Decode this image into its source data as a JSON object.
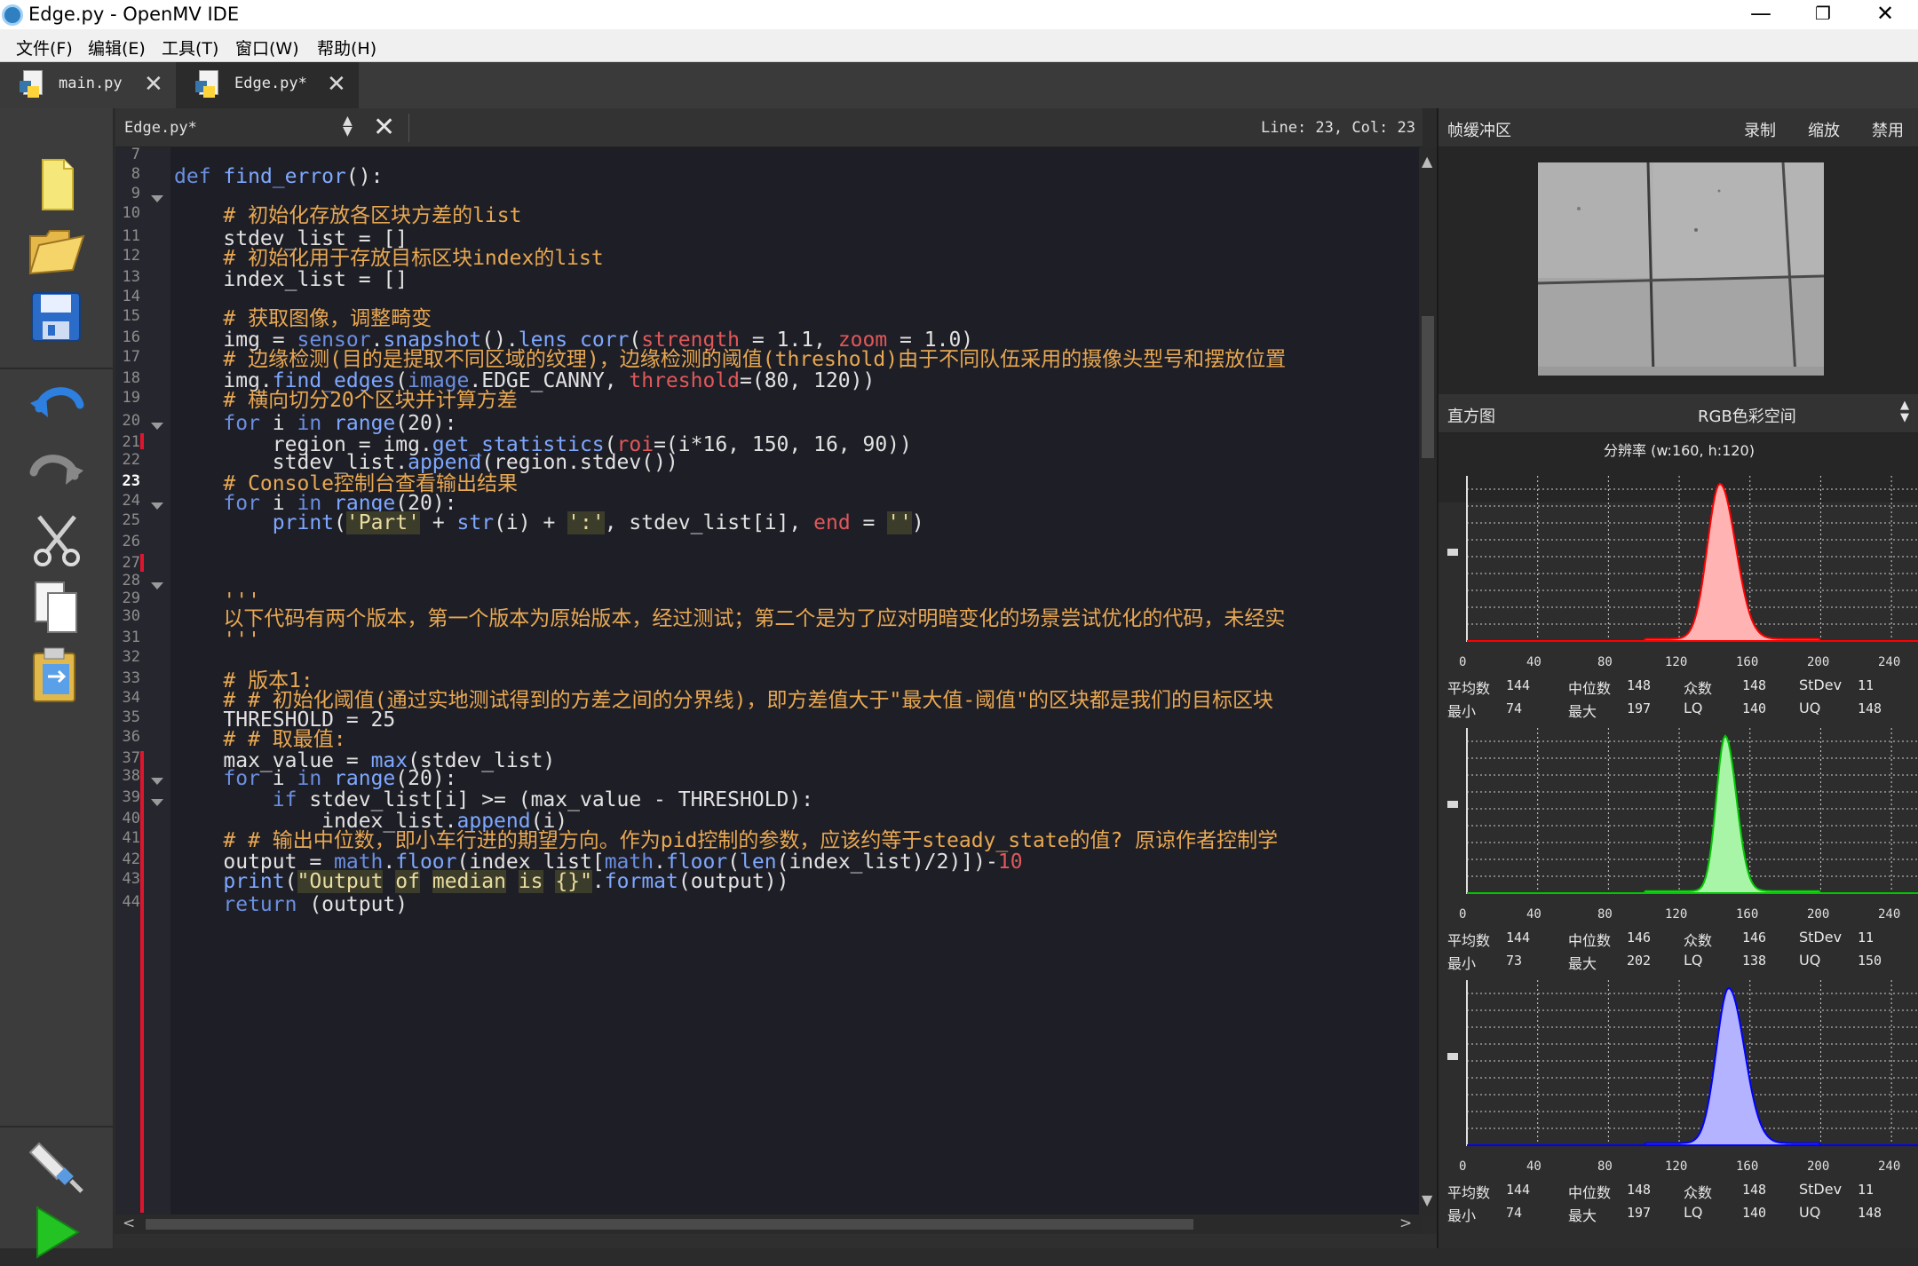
{
  "window": {
    "title": "Edge.py - OpenMV IDE",
    "minimize": "—",
    "restore": "❐",
    "close": "✕"
  },
  "menubar": [
    "文件(F)",
    "编辑(E)",
    "工具(T)",
    "窗口(W)",
    "帮助(H)"
  ],
  "tabs": [
    {
      "label": "main.py",
      "close": "✕"
    },
    {
      "label": "Edge.py*",
      "close": "✕"
    }
  ],
  "toolbar": [
    "new-file",
    "open-folder",
    "save",
    "undo",
    "redo",
    "cut",
    "copy",
    "paste",
    "connect",
    "run"
  ],
  "editor": {
    "doc_name": "Edge.py*",
    "position": "Line: 23, Col: 23",
    "lines": [
      {
        "n": "7",
        "html": ""
      },
      {
        "n": "8",
        "html": "<span class=\"kw\">def</span> <span class=\"fn\">find_error</span>():"
      },
      {
        "n": "9",
        "html": ""
      },
      {
        "n": "10",
        "html": "    <span class=\"cm\"># 初始化存放各区块方差的list</span>"
      },
      {
        "n": "11",
        "html": "    stdev_list = []"
      },
      {
        "n": "12",
        "html": "    <span class=\"cm\"># 初始化用于存放目标区块index的list</span>"
      },
      {
        "n": "13",
        "html": "    index_list = []"
      },
      {
        "n": "14",
        "html": ""
      },
      {
        "n": "15",
        "html": "    <span class=\"cm\"># 获取图像，调整畸变</span>"
      },
      {
        "n": "16",
        "html": "    img = <span class=\"ob\">sensor</span>.<span class=\"fn\">snapshot</span>().<span class=\"fn\">lens_corr</span>(<span class=\"ar\">strength</span> = 1.1, <span class=\"ar\">zoom</span> = 1.0)"
      },
      {
        "n": "17",
        "html": "    <span class=\"cm\"># 边缘检测(目的是提取不同区域的纹理)，边缘检测的阈值(threshold)由于不同队伍采用的摄像头型号和摆放位置</span>"
      },
      {
        "n": "18",
        "html": "    img.<span class=\"fn\">find_edges</span>(<span class=\"ob\">image</span>.EDGE_CANNY, <span class=\"ar\">threshold</span>=(80, 120))"
      },
      {
        "n": "19",
        "html": "    <span class=\"cm\"># 横向切分20个区块并计算方差</span>"
      },
      {
        "n": "20",
        "html": "    <span class=\"kw\">for</span> i <span class=\"kw\">in</span> <span class=\"fn\">range</span>(20):"
      },
      {
        "n": "21",
        "html": "        region = img.<span class=\"fn\">get_statistics</span>(<span class=\"ar\">roi</span>=(i*16, 150, 16, 90))"
      },
      {
        "n": "22",
        "html": "        stdev_list.<span class=\"fn\">append</span>(region.stdev())"
      },
      {
        "n": "23",
        "html": "    <span class=\"cm\"># Console控制台查看输出结果</span>"
      },
      {
        "n": "24",
        "html": "    <span class=\"kw\">for</span> i <span class=\"kw\">in</span> <span class=\"fn\">range</span>(20):"
      },
      {
        "n": "25",
        "html": "        <span class=\"fn\">print</span>(<span class=\"st\">'Part'</span> + <span class=\"fn\">str</span>(i) + <span class=\"st\">':'</span>, stdev_list[i], <span class=\"ar\">end</span> = <span class=\"st\">''</span>)"
      },
      {
        "n": "26",
        "html": ""
      },
      {
        "n": "27",
        "html": ""
      },
      {
        "n": "28",
        "html": ""
      },
      {
        "n": "29",
        "html": "    <span class=\"cm\">'''</span>"
      },
      {
        "n": "30",
        "html": "    <span class=\"cm\">以下代码有两个版本，第一个版本为原始版本，经过测试；第二个是为了应对明暗变化的场景尝试优化的代码，未经实</span>"
      },
      {
        "n": "31",
        "html": "    <span class=\"cm\">'''</span>"
      },
      {
        "n": "32",
        "html": ""
      },
      {
        "n": "33",
        "html": "    <span class=\"cm\"># 版本1:</span>"
      },
      {
        "n": "34",
        "html": "    <span class=\"cm\"># # 初始化阈值(通过实地测试得到的方差之间的分界线)，即方差值大于\"最大值-阈值\"的区块都是我们的目标区块</span>"
      },
      {
        "n": "35",
        "html": "    THRESHOLD = 25"
      },
      {
        "n": "36",
        "html": "    <span class=\"cm\"># # 取最值:</span>"
      },
      {
        "n": "37",
        "html": "    max_value = <span class=\"fn\">max</span>(stdev_list)"
      },
      {
        "n": "38",
        "html": "    <span class=\"kw\">for</span> i <span class=\"kw\">in</span> <span class=\"fn\">range</span>(20):"
      },
      {
        "n": "39",
        "html": "        <span class=\"kw\">if</span> stdev_list[i] >= (max_value - THRESHOLD):"
      },
      {
        "n": "40",
        "html": "            index_list.<span class=\"fn\">append</span>(i)"
      },
      {
        "n": "41",
        "html": "    <span class=\"cm\"># # 输出中位数，即小车行进的期望方向。作为pid控制的参数，应该约等于steady_state的值? 原谅作者控制学</span>"
      },
      {
        "n": "42",
        "html": "    output = <span class=\"ob\">math</span>.<span class=\"fn\">floor</span>(index_list[<span class=\"ob\">math</span>.<span class=\"fn\">floor</span>(<span class=\"fn\">len</span>(index_list)/2)])-<span class=\"ar\">10</span>"
      },
      {
        "n": "43",
        "html": "    <span class=\"fn\">print</span>(<span class=\"st\">\"Output</span> <span class=\"st\">of</span> <span class=\"st\">median</span> <span class=\"st\">is</span> <span class=\"st\">{}\"</span>.<span class=\"fn\">format</span>(output))"
      },
      {
        "n": "44",
        "html": "    <span class=\"kw\">return</span> (output)"
      }
    ]
  },
  "framebuffer": {
    "title": "帧缓冲区",
    "record": "录制",
    "zoom": "缩放",
    "disable": "禁用"
  },
  "histogram": {
    "title": "直方图",
    "colorspace": "RGB色彩空间",
    "resolution": "分辨率 (w:160, h:120)",
    "ticks": [
      "0",
      "40",
      "80",
      "120",
      "160",
      "200",
      "240"
    ],
    "labels": {
      "mean": "平均数",
      "median": "中位数",
      "mode": "众数",
      "stdev": "StDev",
      "min": "最小",
      "max": "最大",
      "lq": "LQ",
      "uq": "UQ"
    },
    "channels": [
      {
        "name": "R",
        "color": "#ff0000",
        "fill": "#ffb3b3",
        "peak": 143,
        "width": 7,
        "stats": {
          "mean": "144",
          "median": "148",
          "mode": "148",
          "stdev": "11",
          "min": "74",
          "max": "197",
          "lq": "140",
          "uq": "148"
        }
      },
      {
        "name": "G",
        "color": "#00c800",
        "fill": "#a8f5a8",
        "peak": 146,
        "width": 5,
        "stats": {
          "mean": "144",
          "median": "146",
          "mode": "146",
          "stdev": "11",
          "min": "73",
          "max": "202",
          "lq": "138",
          "uq": "150"
        }
      },
      {
        "name": "B",
        "color": "#0000ff",
        "fill": "#b3b3ff",
        "peak": 148,
        "width": 7,
        "stats": {
          "mean": "144",
          "median": "148",
          "mode": "148",
          "stdev": "11",
          "min": "74",
          "max": "197",
          "lq": "140",
          "uq": "148"
        }
      }
    ]
  }
}
